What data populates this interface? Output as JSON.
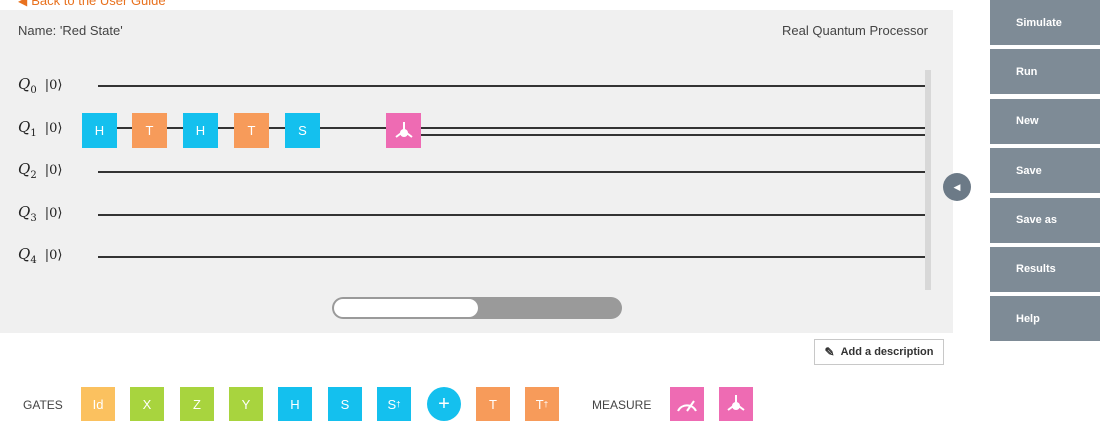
{
  "back_link": "Back to the User Guide",
  "composer": {
    "name_label": "Name: 'Red State'",
    "device_label": "Real Quantum Processor",
    "qubits": [
      {
        "base": "Q",
        "index": "0",
        "ket": "|0⟩"
      },
      {
        "base": "Q",
        "index": "1",
        "ket": "|0⟩"
      },
      {
        "base": "Q",
        "index": "2",
        "ket": "|0⟩"
      },
      {
        "base": "Q",
        "index": "3",
        "ket": "|0⟩"
      },
      {
        "base": "Q",
        "index": "4",
        "ket": "|0⟩"
      }
    ],
    "circuit_gates": [
      "H",
      "T",
      "H",
      "T",
      "S"
    ],
    "hscroll_fraction": 0.5
  },
  "sidebar": {
    "buttons": [
      "Simulate",
      "Run",
      "New",
      "Save",
      "Save as",
      "Results",
      "Help"
    ]
  },
  "description_button": "Add a description",
  "palette": {
    "gates_label": "GATES",
    "gates": [
      "Id",
      "X",
      "Z",
      "Y",
      "H",
      "S",
      "S",
      "+",
      "T",
      "T"
    ],
    "dagger": "†",
    "measure_label": "MEASURE"
  },
  "colors": {
    "cyan": "#14c0ee",
    "orange": "#f79b5a",
    "pink": "#ee6bb3",
    "yellow": "#fbc15f",
    "green": "#a8d43e",
    "sidebar": "#7e8b96",
    "link": "#e8711e"
  },
  "icons": [
    "arrow-left-icon",
    "measure-icon",
    "bloch-measure-icon",
    "pencil-icon",
    "chevron-left-icon",
    "plus-icon"
  ]
}
